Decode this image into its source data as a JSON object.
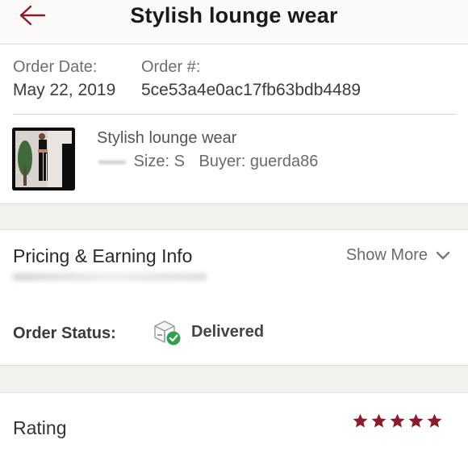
{
  "header": {
    "title": "Stylish lounge wear",
    "back_icon": "arrow-left-icon",
    "back_color": "#8b1a2b"
  },
  "order": {
    "date_label": "Order Date:",
    "date_value": "May 22, 2019",
    "number_label": "Order #:",
    "number_value": "5ce53a4e0ac17fb63bdb4489"
  },
  "item": {
    "name": "Stylish lounge wear",
    "size": "Size: S",
    "buyer": "Buyer: guerda86"
  },
  "pricing": {
    "title": "Pricing & Earning Info",
    "show_more": "Show More"
  },
  "status": {
    "label": "Order Status:",
    "value": "Delivered",
    "icon": "package-delivered-icon",
    "check_color": "#2fa24a"
  },
  "rating": {
    "label": "Rating",
    "stars": 5,
    "max": 5,
    "star_color": "#8b1a2b"
  }
}
